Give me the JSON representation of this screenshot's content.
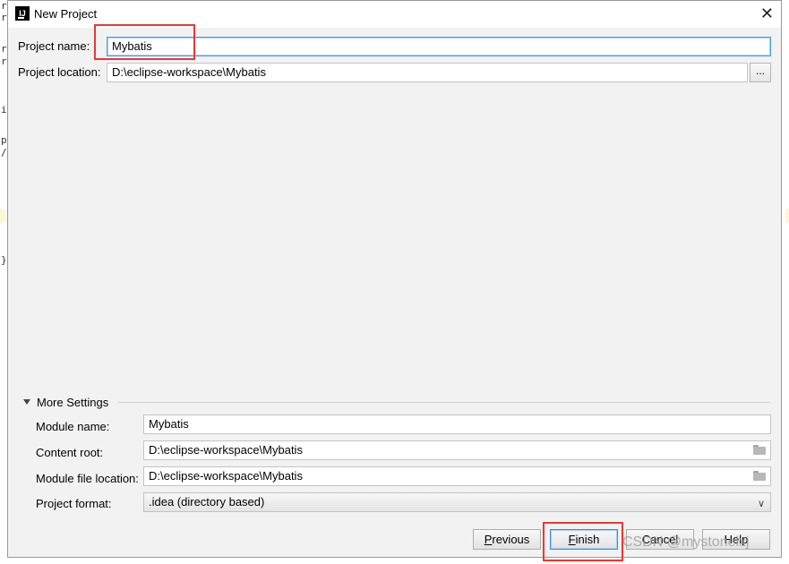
{
  "window": {
    "title": "New Project",
    "close_glyph": "✕",
    "app_icon_letters": "IJ"
  },
  "background_code": [
    "r",
    "r",
    "r",
    "r",
    "i",
    "p",
    "/",
    "}"
  ],
  "project": {
    "name_label": "Project name:",
    "name_value": "Mybatis",
    "location_label": "Project location:",
    "location_value": "D:\\eclipse-workspace\\Mybatis",
    "browse_label": "..."
  },
  "more_settings": {
    "header": "More Settings",
    "module_name_label": "Module name:",
    "module_name_value": "Mybatis",
    "content_root_label": "Content root:",
    "content_root_value": "D:\\eclipse-workspace\\Mybatis",
    "module_file_label": "Module file location:",
    "module_file_value": "D:\\eclipse-workspace\\Mybatis",
    "format_label": "Project format:",
    "format_value": ".idea (directory based)"
  },
  "buttons": {
    "previous": {
      "mnemonic": "P",
      "rest": "revious"
    },
    "finish": {
      "mnemonic": "F",
      "rest": "inish"
    },
    "cancel": "Cancel",
    "help": "Help"
  },
  "watermark": "CSDN @mystonelxj",
  "colors": {
    "highlight": "#e53935",
    "focus": "#4a9be0",
    "dialog_bg": "#f2f2f2"
  },
  "icons": [
    "intellij-app-icon",
    "close-icon",
    "folder-icon",
    "triangle-down-icon",
    "chevron-down-icon"
  ]
}
